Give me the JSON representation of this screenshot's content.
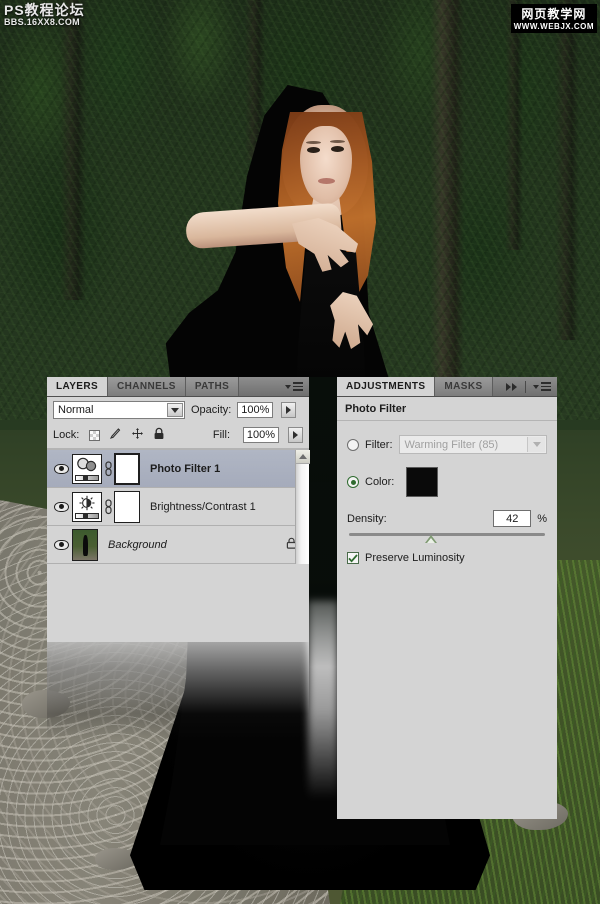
{
  "watermarks": {
    "top_left_cn": "PS教程论坛",
    "top_left_url": "BBS.16XX8.COM",
    "top_right_cn": "网页教学网",
    "top_right_url": "WWW.WEBJX.COM"
  },
  "layers_panel": {
    "tabs": [
      {
        "label": "LAYERS",
        "active": true
      },
      {
        "label": "CHANNELS",
        "active": false
      },
      {
        "label": "PATHS",
        "active": false
      }
    ],
    "blend_mode": "Normal",
    "opacity_label": "Opacity:",
    "opacity_value": "100%",
    "lock_label": "Lock:",
    "lock_icons": [
      "lock-transparent-pixels",
      "lock-image-pixels",
      "lock-position",
      "lock-all"
    ],
    "fill_label": "Fill:",
    "fill_value": "100%",
    "layers": [
      {
        "name": "Photo Filter 1",
        "visible": true,
        "selected": true,
        "type": "adjustment",
        "thumb_icon": "photo-filter-icon",
        "has_mask": true,
        "locked": false
      },
      {
        "name": "Brightness/Contrast 1",
        "visible": true,
        "selected": false,
        "type": "adjustment",
        "thumb_icon": "brightness-contrast-icon",
        "has_mask": true,
        "locked": false
      },
      {
        "name": "Background",
        "visible": true,
        "selected": false,
        "type": "image",
        "thumb_icon": "photo-thumbnail",
        "has_mask": false,
        "locked": true
      }
    ]
  },
  "adjustments_panel": {
    "tabs": [
      {
        "label": "ADJUSTMENTS",
        "active": true
      },
      {
        "label": "MASKS",
        "active": false
      }
    ],
    "title": "Photo Filter",
    "filter_label": "Filter:",
    "filter_value": "Warming Filter (85)",
    "filter_selected": false,
    "color_label": "Color:",
    "color_selected": true,
    "color_value": "#0a0a0a",
    "density_label": "Density:",
    "density_value": "42",
    "density_unit": "%",
    "density_percent": 42,
    "preserve_luminosity_label": "Preserve Luminosity",
    "preserve_luminosity_checked": true
  },
  "colors": {
    "panel_bg": "#d4d4d4",
    "tab_active_bg": "#d4d4d4",
    "selected_layer": "#a9afbf",
    "accent_green": "#2f6b2f"
  }
}
